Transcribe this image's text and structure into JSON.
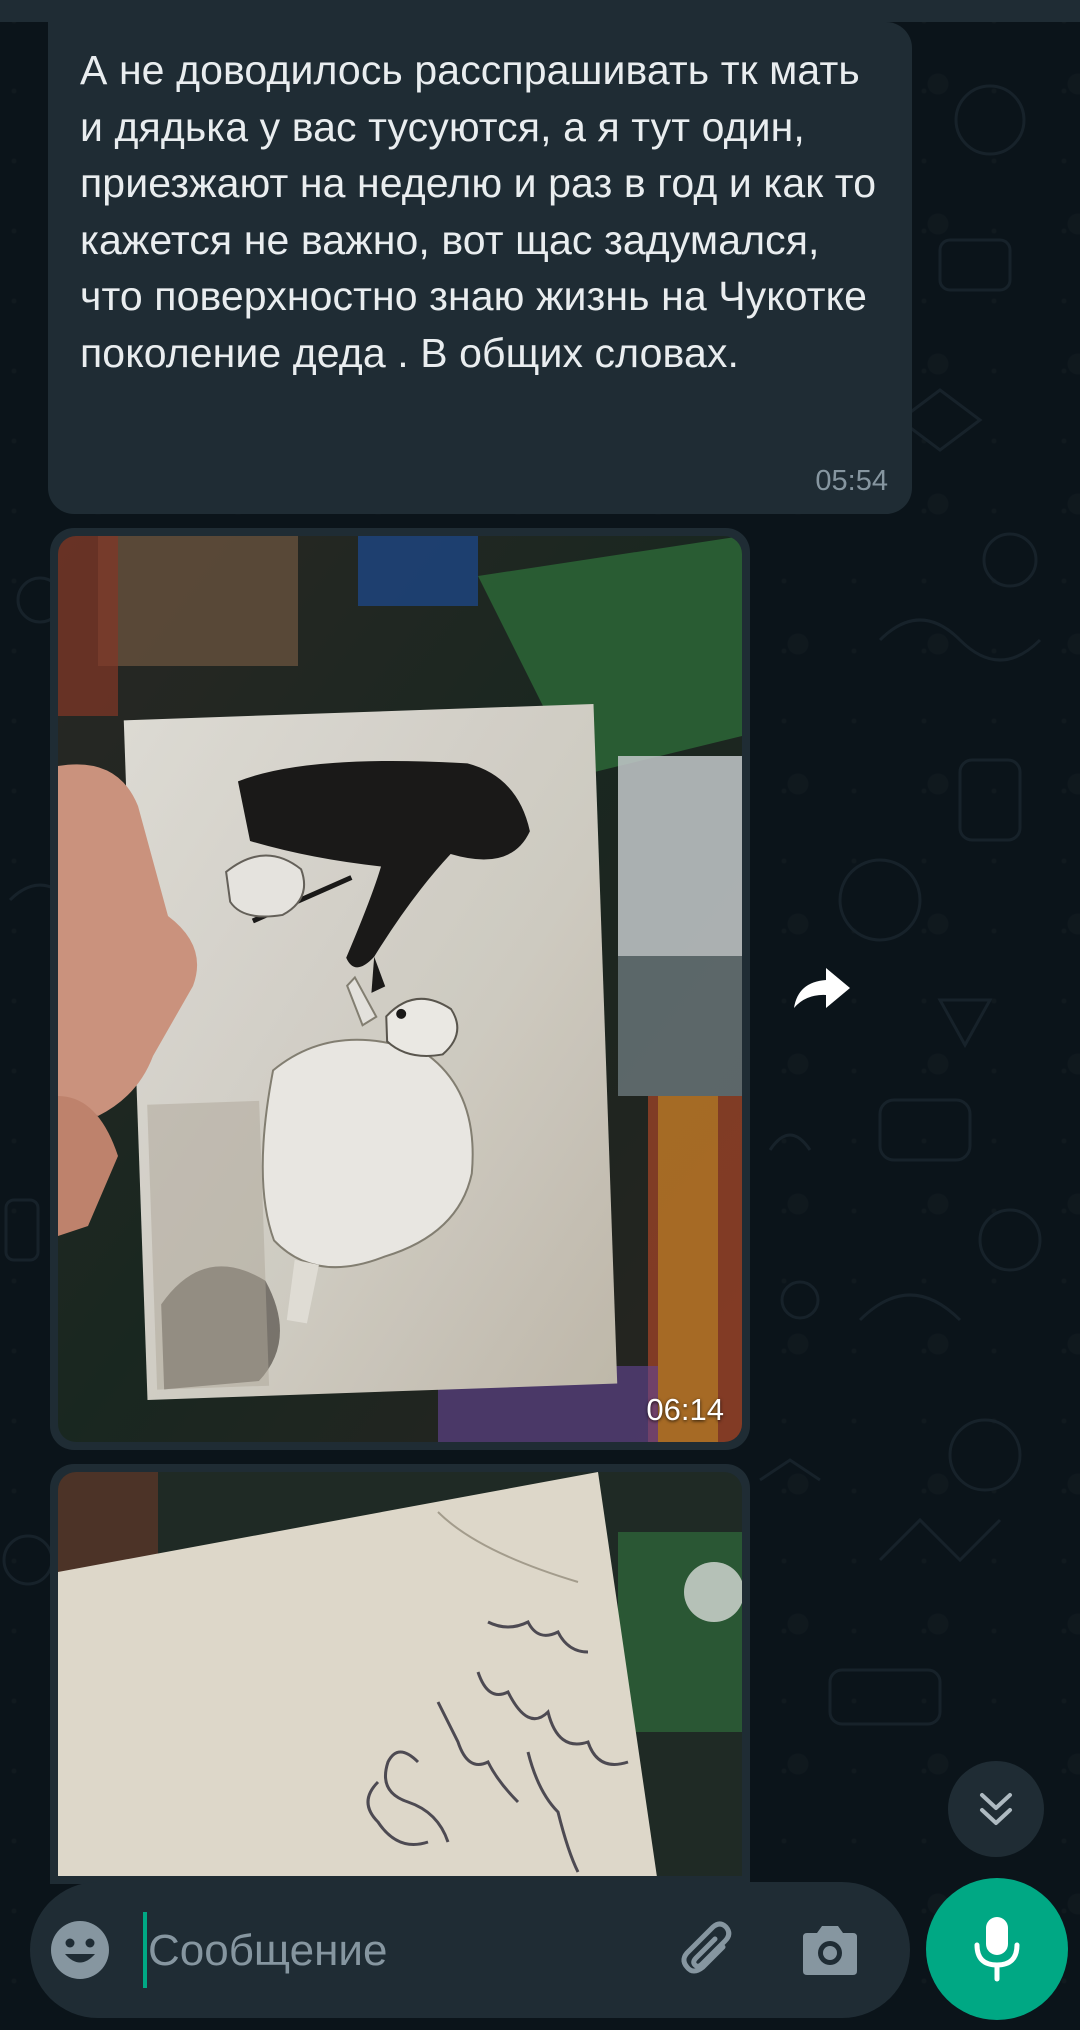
{
  "chat": {
    "messages": [
      {
        "type": "text",
        "text": "А не доводилось расспрашивать тк мать и дядька у вас тусуются, а я тут один, приезжают на неделю и раз в год и как то кажется не важно, вот щас задумался, что поверхностно знаю жизнь на Чукотке поколение деда . В общих словах.",
        "time": "05:54"
      },
      {
        "type": "image",
        "description_icon": "photo-polar-bear",
        "time": "06:14"
      },
      {
        "type": "image",
        "description_icon": "photo-back-handwriting",
        "time": ""
      }
    ]
  },
  "composer": {
    "placeholder": "Сообщение"
  },
  "icons": {
    "forward": "forward-icon",
    "scroll_down": "double-chevron-down-icon",
    "emoji": "emoji-icon",
    "attach": "paperclip-icon",
    "camera": "camera-icon",
    "mic": "mic-icon"
  },
  "colors": {
    "background": "#0b141a",
    "bubble": "#1f2c34",
    "accent": "#00a884",
    "text": "#e9edef",
    "meta": "#8696a0"
  }
}
